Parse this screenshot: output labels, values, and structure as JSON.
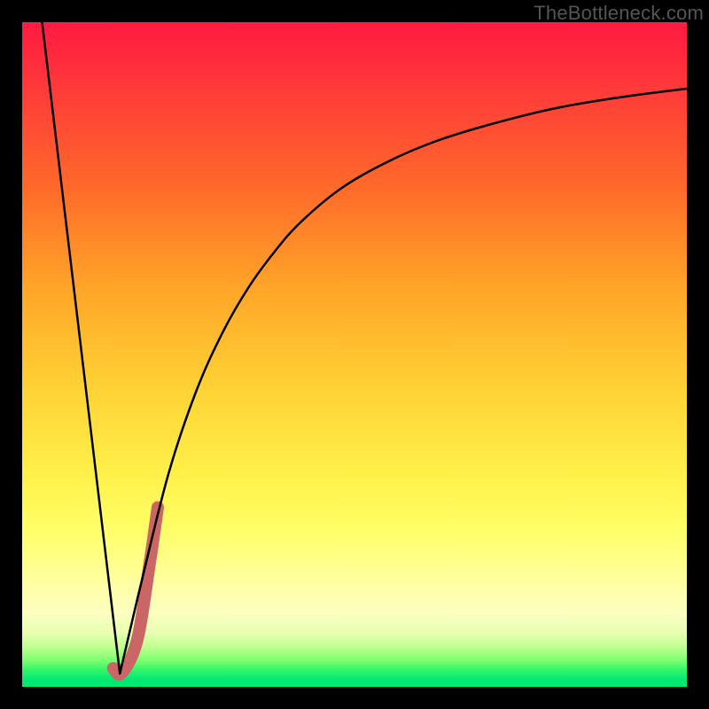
{
  "watermark": "TheBottleneck.com",
  "chart_data": {
    "type": "line",
    "title": "",
    "xlabel": "",
    "ylabel": "",
    "x_range": [
      0,
      100
    ],
    "y_range": [
      0,
      100
    ],
    "grid": false,
    "series": [
      {
        "name": "left-branch",
        "x": [
          3,
          14.7
        ],
        "y": [
          100,
          2
        ],
        "stroke": "#000000",
        "width": 2.5
      },
      {
        "name": "right-branch",
        "x": [
          14.7,
          18,
          22,
          26,
          30,
          34,
          38,
          42,
          48,
          55,
          62,
          70,
          80,
          90,
          100
        ],
        "y": [
          2,
          16,
          32,
          44,
          53,
          60,
          65.5,
          70,
          75,
          79,
          82,
          84.5,
          87,
          88.7,
          90
        ],
        "stroke": "#000000",
        "width": 2.5
      },
      {
        "name": "highlight-segment",
        "x": [
          13.7,
          15,
          17.3,
          19.1,
          20.4
        ],
        "y": [
          2.8,
          2.1,
          7,
          18,
          27
        ],
        "stroke": "#cc6666",
        "width": 14
      }
    ]
  }
}
